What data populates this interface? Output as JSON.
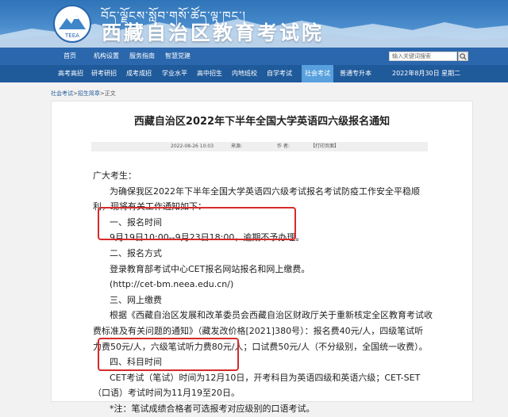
{
  "header": {
    "site_title": "西藏自治区教育考试院",
    "site_title_tibetan": "བོད་ལྗོངས་སློབ་གསོ་ཚོད་ལྟ་ཁང་།",
    "logo_text": "TEEA"
  },
  "topnav": {
    "items": [
      "首页",
      "机构设置",
      "服务指南",
      "智慧党建"
    ],
    "search_placeholder": "输入关键词搜索"
  },
  "subnav": {
    "items": [
      "高考高招",
      "研考研招",
      "成考成招",
      "学业水平",
      "高中招生",
      "内地班校",
      "自学考试",
      "社会考试",
      "普通专升本"
    ],
    "active_index": 7,
    "date": "2022年8月30日 星期二"
  },
  "breadcrumb": {
    "items": [
      "社会考试",
      "招生简章",
      "正文"
    ]
  },
  "article": {
    "title": "西藏自治区2022年下半年全国大学英语四六级报名通知",
    "meta": {
      "date": "2022-08-26 10:03",
      "source": "来源:",
      "author": "作 者:",
      "print": "【打印页面】"
    },
    "lines": [
      "广大考生：",
      "为确保我区2022年下半年全国大学英语四六级考试报名考试防疫工作安全平稳顺",
      "利，现将有关工作通知如下：",
      "一、报名时间",
      "9月19日10:00--9月23日18:00，逾期不予办理。",
      "二、报名方式",
      "登录教育部考试中心CET报名网站报名和网上缴费。",
      "(http://cet-bm.neea.edu.cn/)",
      "三、网上缴费",
      "根据《西藏自治区发展和改革委员会西藏自治区财政厅关于重新核定全区教育考试收",
      "费标准及有关问题的通知》（藏发改价格[2021]380号）：报名费40元/人，四级笔试听",
      "力费50元/人，六级笔试听力费80元/人；口试费50元/人（不分级别，全国统一收费）。",
      "四、科目时间",
      "CET考试（笔试）时间为12月10日，开考科目为英语四级和英语六级；CET-SET",
      "（口语）考试时间为11月19至20日。",
      "*注：笔试成绩合格者可选报考对应级别的口语考试。"
    ]
  },
  "colors": {
    "topnav_bg": "#2a67ad",
    "subnav_bg": "#1f5a9b",
    "active_tab": "#58a0de",
    "highlight_box": "#d72b2b"
  }
}
